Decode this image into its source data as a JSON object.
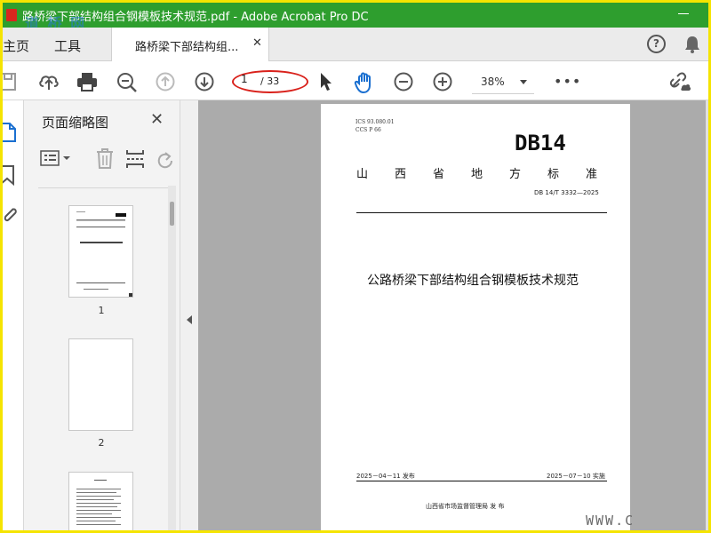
{
  "window": {
    "title": "路桥梁下部结构组合钢模板技术规范.pdf - Adobe Acrobat Pro DC",
    "watermark": "道 桥 网"
  },
  "tabs": {
    "home": "主页",
    "tools": "工具",
    "document": "路桥梁下部结构组..."
  },
  "toolbar": {
    "page_current": "1",
    "page_total": "/ 33",
    "zoom": "38%",
    "more": "•••"
  },
  "thumbnails": {
    "title": "页面缩略图",
    "pages": [
      "1",
      "2"
    ]
  },
  "document": {
    "ics": "ICS  93.080.01",
    "ccs": "CCS  P 66",
    "logo": "DB14",
    "standard_title": "山西省地方标准",
    "standard_code": "DB 14/T 3332—2025",
    "title": "公路桥梁下部结构组合钢模板技术规范",
    "issue_date": "2025－04－11 发布",
    "implementation_date": "2025－07－10 实施",
    "publisher": "山西省市场监督管理局    发  布"
  },
  "footer_watermark": "WWW.C",
  "colors": {
    "titlebar": "#2e9e2e",
    "highlight_ellipse": "#d9211b",
    "border": "#f5e400"
  }
}
